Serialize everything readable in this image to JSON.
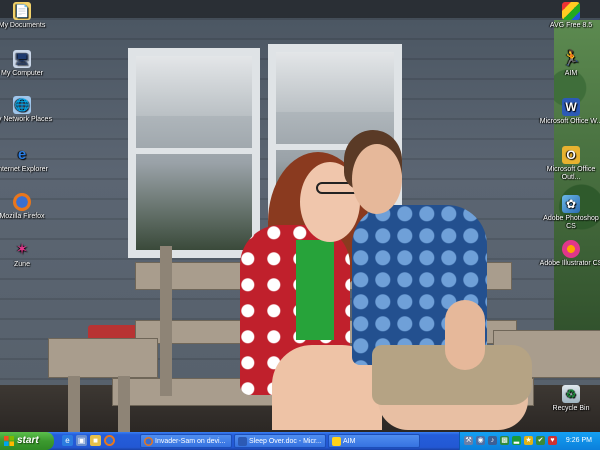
{
  "desktop": {
    "icons_left": [
      {
        "label": "My Documents",
        "icon": "folder-documents-icon"
      },
      {
        "label": "My Computer",
        "icon": "computer-icon"
      },
      {
        "label": "My Network Places",
        "icon": "network-places-icon"
      },
      {
        "label": "Internet Explorer",
        "icon": "internet-explorer-icon"
      },
      {
        "label": "Mozilla Firefox",
        "icon": "firefox-icon"
      },
      {
        "label": "Zune",
        "icon": "zune-icon"
      }
    ],
    "icons_right": [
      {
        "label": "AVG Free 8.5",
        "icon": "avg-icon"
      },
      {
        "label": "AIM",
        "icon": "aim-running-man-icon"
      },
      {
        "label": "Microsoft Office W...",
        "icon": "word-icon"
      },
      {
        "label": "Microsoft Office Outl...",
        "icon": "outlook-icon"
      },
      {
        "label": "Adobe Photoshop CS",
        "icon": "photoshop-icon"
      },
      {
        "label": "Adobe Illustrator CS",
        "icon": "illustrator-icon"
      },
      {
        "label": "Recycle Bin",
        "icon": "recycle-bin-icon"
      }
    ]
  },
  "taskbar": {
    "start_label": "start",
    "quick_launch": [
      "ie-icon",
      "show-desktop-icon",
      "folder-icon",
      "firefox-icon"
    ],
    "tasks": [
      {
        "label": "Invader-Sam on devi...",
        "icon": "firefox-icon"
      },
      {
        "label": "Sleep Over.doc - Micr...",
        "icon": "word-icon"
      },
      {
        "label": "AIM",
        "icon": "aim-running-man-icon"
      }
    ],
    "tray_icons": [
      "tool-icon",
      "connection-icon",
      "volume-icon",
      "network-icon",
      "signal-icon",
      "av-icon",
      "safe-remove-icon",
      "shield-icon"
    ],
    "clock": "9:26 PM"
  },
  "colors": {
    "taskbar": "#245edb",
    "start": "#3c9a2f",
    "tray": "#0b7fdb"
  }
}
